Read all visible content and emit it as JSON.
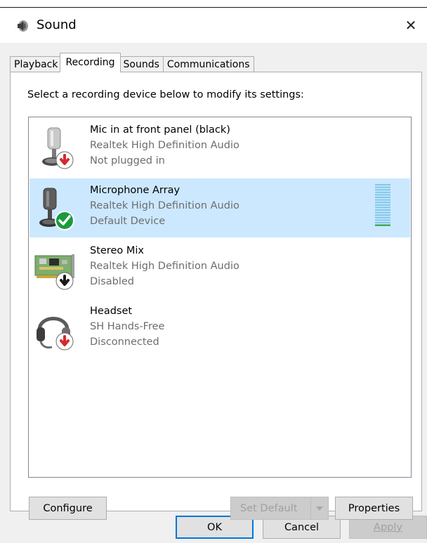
{
  "window": {
    "title": "Sound",
    "close_glyph": "✕"
  },
  "tabs": [
    {
      "label": "Playback",
      "active": false
    },
    {
      "label": "Recording",
      "active": true
    },
    {
      "label": "Sounds",
      "active": false
    },
    {
      "label": "Communications",
      "active": false
    }
  ],
  "instruction": "Select a recording device below to modify its settings:",
  "devices": [
    {
      "name": "Mic in at front panel (black)",
      "driver": "Realtek High Definition Audio",
      "status": "Not plugged in",
      "icon": "microphone-icon",
      "badge": "red-down-arrow-badge",
      "selected": false
    },
    {
      "name": "Microphone Array",
      "driver": "Realtek High Definition Audio",
      "status": "Default Device",
      "icon": "microphone-icon",
      "badge": "green-check-badge",
      "selected": true
    },
    {
      "name": "Stereo Mix",
      "driver": "Realtek High Definition Audio",
      "status": "Disabled",
      "icon": "sound-card-icon",
      "badge": "black-down-arrow-badge",
      "selected": false
    },
    {
      "name": "Headset",
      "driver": "SH Hands-Free",
      "status": "Disconnected",
      "icon": "headset-icon",
      "badge": "red-down-arrow-badge",
      "selected": false
    }
  ],
  "level_meter": {
    "active_fraction": 0.06
  },
  "buttons": {
    "configure": "Configure",
    "set_default": "Set Default",
    "properties": "Properties",
    "ok": "OK",
    "cancel": "Cancel",
    "apply": "Apply"
  },
  "colors": {
    "selection": "#cce8ff",
    "meter_on": "#1f9d3a",
    "meter_off": "#7fc8e6",
    "focus": "#0078d7"
  }
}
